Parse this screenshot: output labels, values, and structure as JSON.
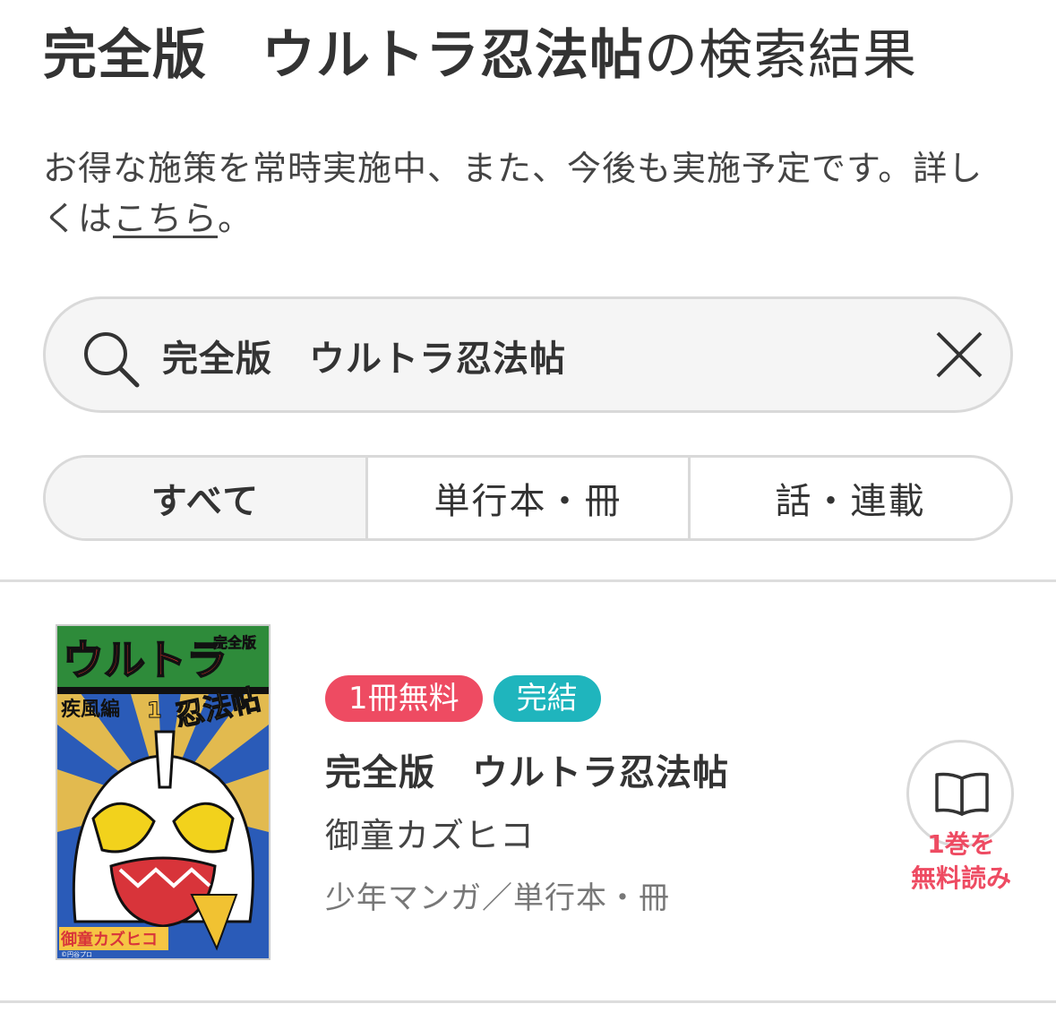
{
  "header": {
    "query": "完全版　ウルトラ忍法帖",
    "suffix": "の検索結果"
  },
  "notice": {
    "text_before": "お得な施策を常時実施中、また、今後も実施予定です。詳しくは",
    "link": "こちら",
    "text_after": "。"
  },
  "search": {
    "value": "完全版　ウルトラ忍法帖",
    "icon": "search-icon",
    "clear_icon": "close-icon"
  },
  "tabs": [
    {
      "label": "すべて",
      "active": true
    },
    {
      "label": "単行本・冊",
      "active": false
    },
    {
      "label": "話・連載",
      "active": false
    }
  ],
  "result": {
    "badges": {
      "free": "1冊無料",
      "complete": "完結"
    },
    "title": "完全版　ウルトラ忍法帖",
    "author": "御童カズヒコ",
    "category": "少年マンガ／単行本・冊",
    "read_icon": "open-book-icon",
    "read_label_line1": "1巻を",
    "read_label_line2": "無料読み",
    "cover": {
      "logo": "ウルトラ",
      "edition": "完全版",
      "subtitle": "疾風編",
      "volume": "1",
      "series": "忍法帖",
      "author_mark": "御童カズヒコ",
      "copyright": "©円谷プロ"
    }
  },
  "colors": {
    "badge_free": "#ee4b62",
    "badge_complete": "#1fb5bd",
    "read_label": "#ee4b62",
    "border": "#d9d9d9"
  }
}
